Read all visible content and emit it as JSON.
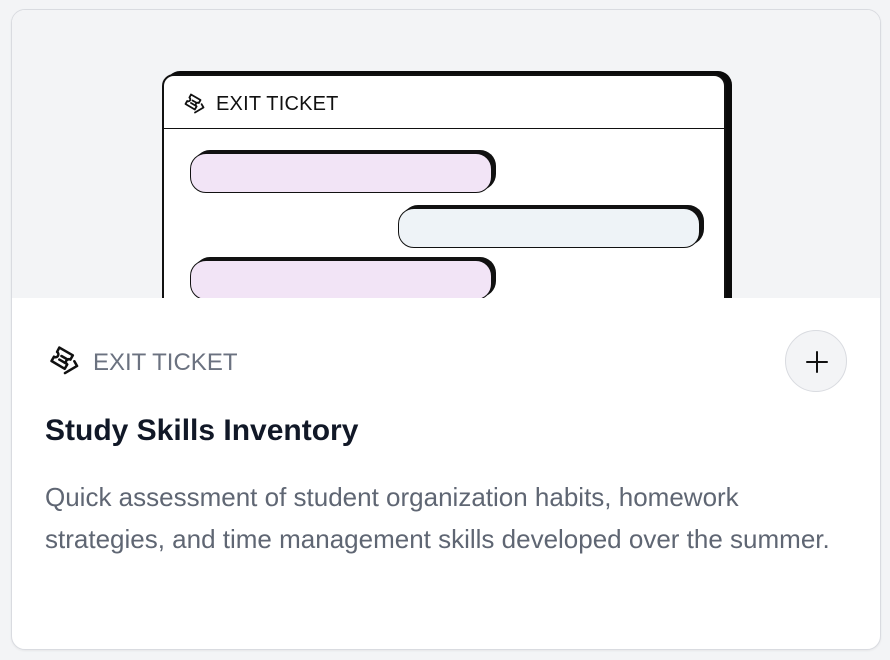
{
  "preview": {
    "window_title": "EXIT TICKET",
    "window_icon": "ticket-icon"
  },
  "card": {
    "type_label": "EXIT TICKET",
    "type_icon": "ticket-icon",
    "title": "Study Skills Inventory",
    "description": "Quick assessment of student organization habits, homework strategies, and time management skills developed over the summer.",
    "add_button_icon": "plus-icon"
  },
  "colors": {
    "page_background": "#f3f4f6",
    "card_background": "#ffffff",
    "bubble_pink": "#f2e4f6",
    "bubble_blue": "#eef3f7",
    "title_color": "#111827",
    "muted_text": "#6b7280"
  }
}
